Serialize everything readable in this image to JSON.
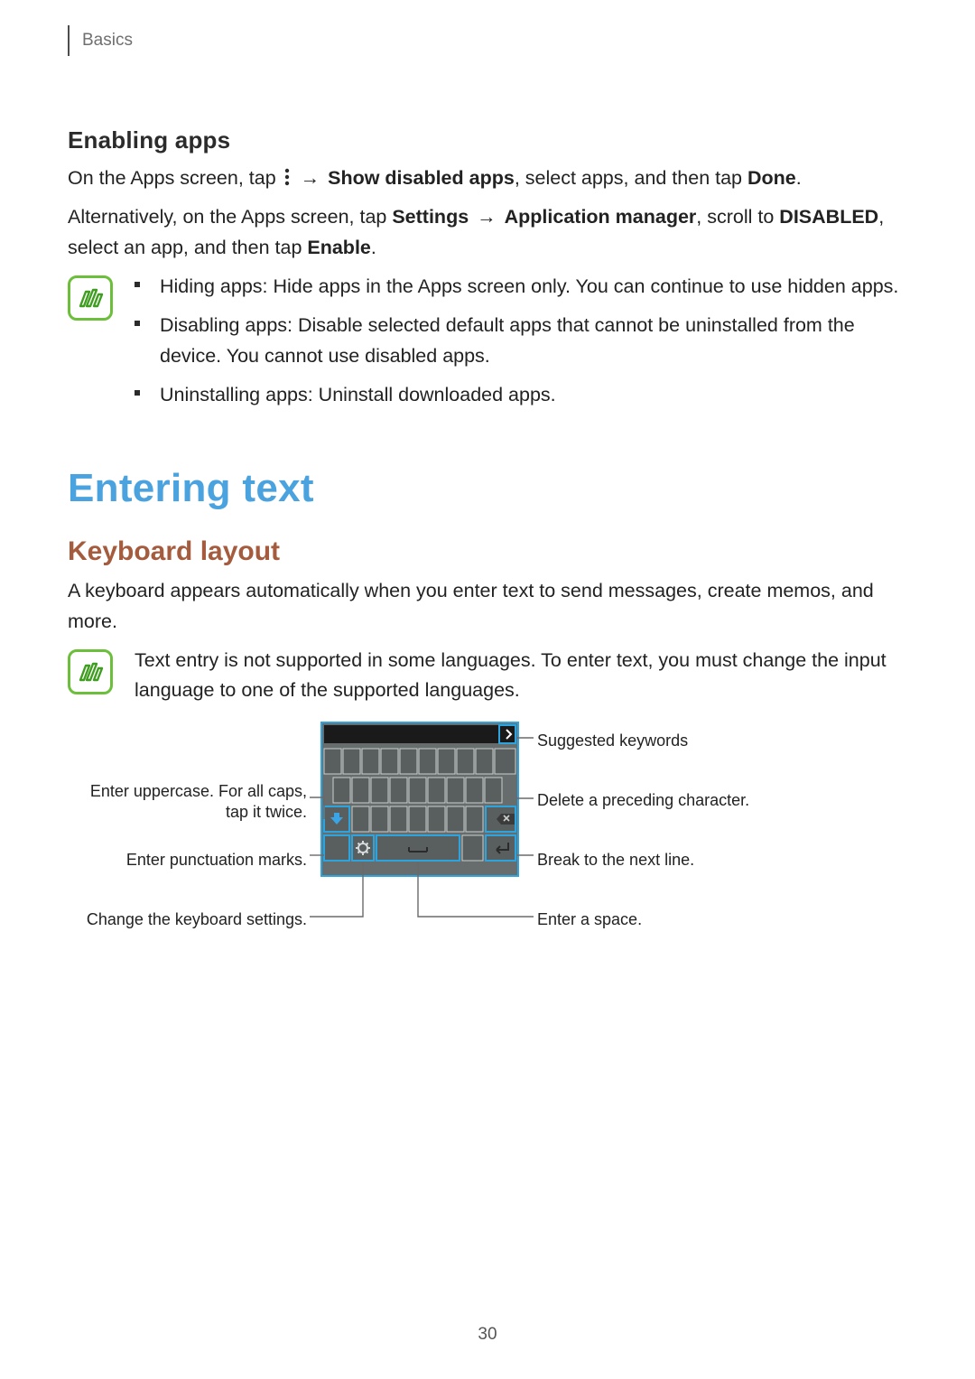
{
  "header": {
    "breadcrumb": "Basics"
  },
  "enabling_apps": {
    "heading": "Enabling apps",
    "line1_pre": "On the Apps screen, tap ",
    "line1_arrow": "→",
    "line1_bold1": "Show disabled apps",
    "line1_mid": ", select apps, and then tap ",
    "line1_bold2": "Done",
    "line1_post": ".",
    "line2_pre": "Alternatively, on the Apps screen, tap ",
    "line2_bold1": "Settings",
    "line2_arrow": "→",
    "line2_bold2": "Application manager",
    "line2_mid": ", scroll to ",
    "line2_bold3": "DISABLED",
    "line2_post": ", select an app, and then tap ",
    "line2_bold4": "Enable",
    "line2_end": ".",
    "bullets": [
      "Hiding apps: Hide apps in the Apps screen only. You can continue to use hidden apps.",
      "Disabling apps: Disable selected default apps that cannot be uninstalled from the device. You cannot use disabled apps.",
      "Uninstalling apps: Uninstall downloaded apps."
    ]
  },
  "entering_text": {
    "heading": "Entering text",
    "keyboard_layout": {
      "heading": "Keyboard layout",
      "intro": "A keyboard appears automatically when you enter text to send messages, create memos, and more.",
      "note": "Text entry is not supported in some languages. To enter text, you must change the input language to one of the supported languages.",
      "callouts": {
        "suggested": "Suggested keywords",
        "uppercase": "Enter uppercase. For all caps, tap it twice.",
        "delete": "Delete a preceding character.",
        "punct": "Enter punctuation marks.",
        "linebreak": "Break to the next line.",
        "settings": "Change the keyboard settings.",
        "space": "Enter a space."
      }
    }
  },
  "page_number": "30"
}
